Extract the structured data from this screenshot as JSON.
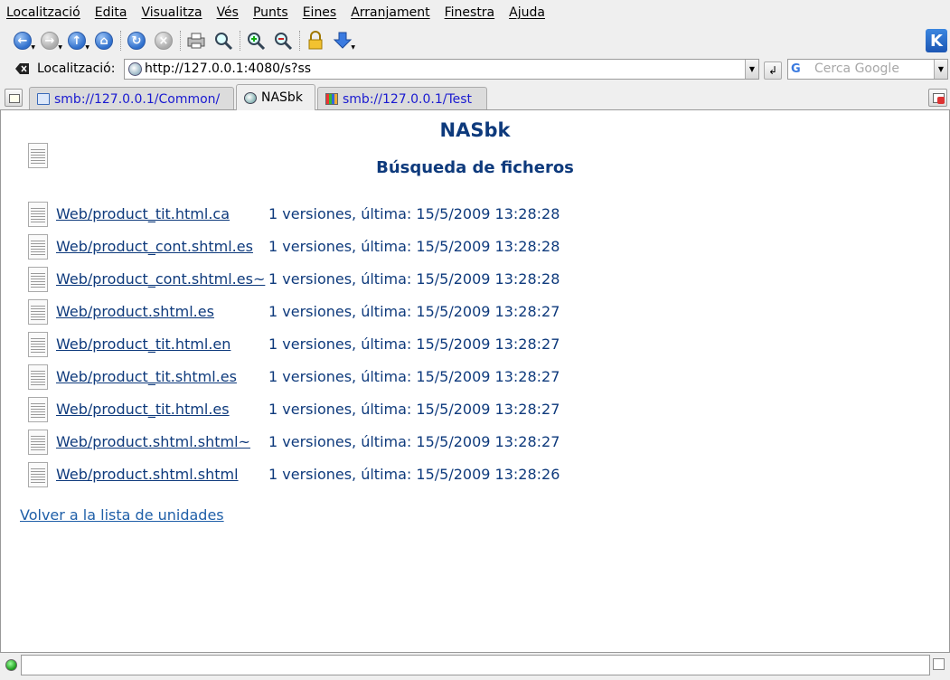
{
  "menubar": {
    "items": [
      {
        "label": "Localització"
      },
      {
        "label": "Edita"
      },
      {
        "label": "Visualitza"
      },
      {
        "label": "Vés"
      },
      {
        "label": "Punts"
      },
      {
        "label": "Eines"
      },
      {
        "label": "Arranjament"
      },
      {
        "label": "Finestra"
      },
      {
        "label": "Ajuda"
      }
    ]
  },
  "toolbar": {
    "icons": [
      "back-icon",
      "forward-icon",
      "up-icon",
      "home-icon",
      "reload-icon",
      "stop-icon",
      "print-icon",
      "find-icon",
      "zoom-in-icon",
      "zoom-out-icon",
      "security-lock-icon",
      "download-icon",
      "kde-logo-icon"
    ]
  },
  "location": {
    "label": "Localització:",
    "url": "http://127.0.0.1:4080/s?ss",
    "search_placeholder": "Cerca Google"
  },
  "tabs": [
    {
      "label": "smb://127.0.0.1/Common/",
      "active": false
    },
    {
      "label": "NASbk",
      "active": true
    },
    {
      "label": "smb://127.0.0.1/Test",
      "active": false
    }
  ],
  "page": {
    "title": "NASbk",
    "subtitle": "Búsqueda de ficheros",
    "files": [
      {
        "name": "Web/product_tit.html.ca",
        "info": "1 versiones, última: 15/5/2009 13:28:28"
      },
      {
        "name": "Web/product_cont.shtml.es",
        "info": "1 versiones, última: 15/5/2009 13:28:28"
      },
      {
        "name": "Web/product_cont.shtml.es~",
        "info": "1 versiones, última: 15/5/2009 13:28:28"
      },
      {
        "name": "Web/product.shtml.es",
        "info": "1 versiones, última: 15/5/2009 13:28:27"
      },
      {
        "name": "Web/product_tit.html.en",
        "info": "1 versiones, última: 15/5/2009 13:28:27"
      },
      {
        "name": "Web/product_tit.shtml.es",
        "info": "1 versiones, última: 15/5/2009 13:28:27"
      },
      {
        "name": "Web/product_tit.html.es",
        "info": "1 versiones, última: 15/5/2009 13:28:27"
      },
      {
        "name": "Web/product.shtml.shtml~",
        "info": "1 versiones, última: 15/5/2009 13:28:27"
      },
      {
        "name": "Web/product.shtml.shtml",
        "info": "1 versiones, última: 15/5/2009 13:28:26"
      }
    ],
    "back_link": "Volver a la lista de unidades"
  },
  "colors": {
    "heading": "#0e3a7c",
    "link": "#0e3a7c",
    "back_link": "#1f5fa8"
  }
}
